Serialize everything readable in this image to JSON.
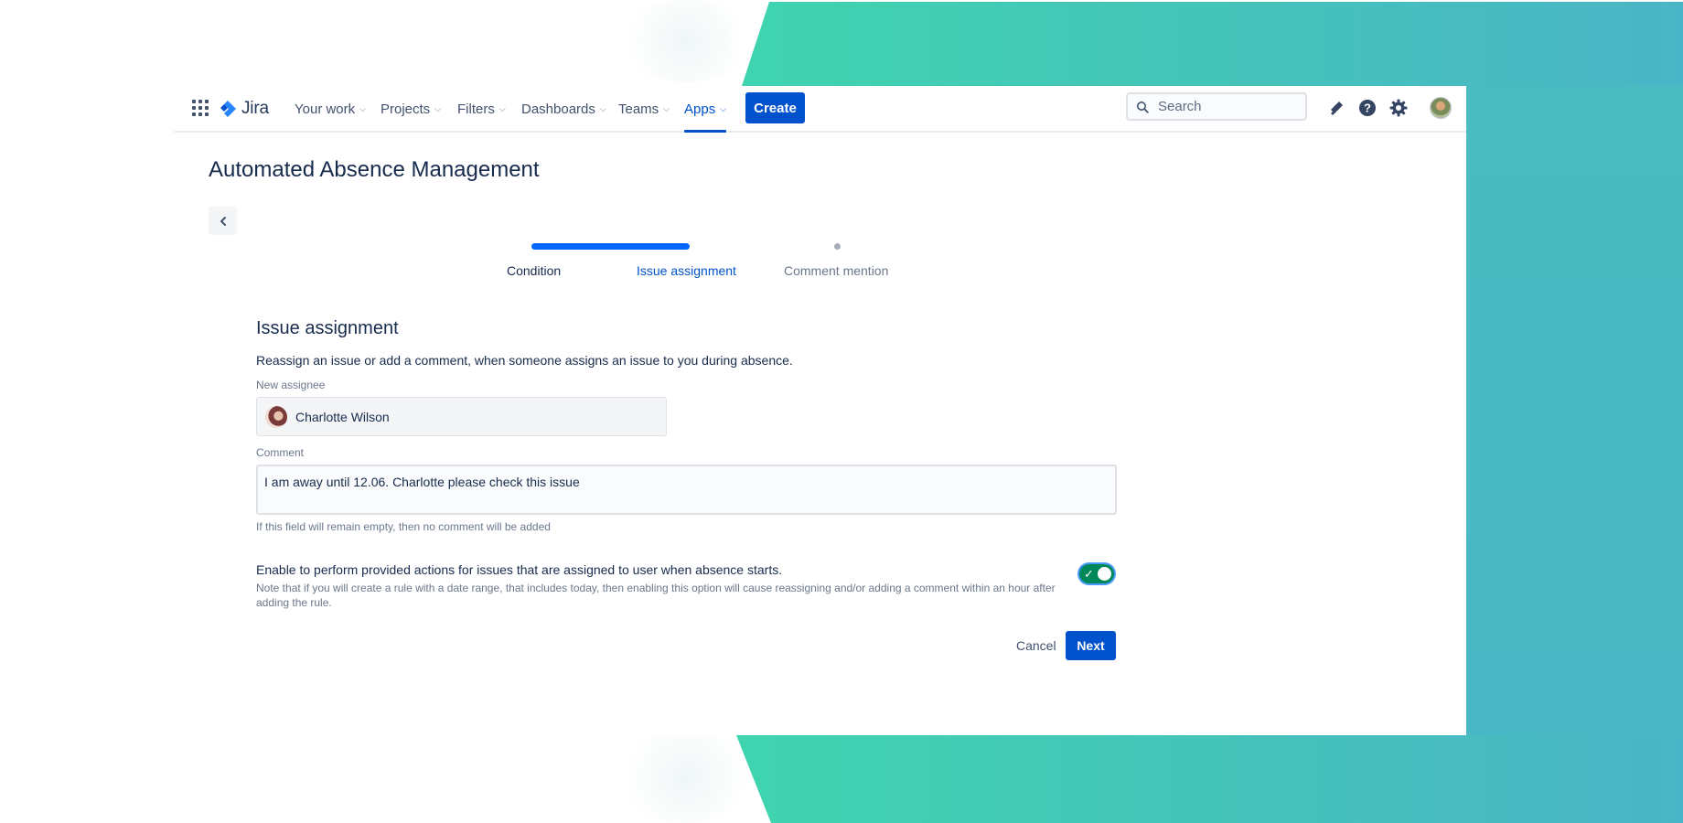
{
  "theme": {
    "brand": "#0052cc",
    "accent": "#0065ff",
    "toggle_on": "#00875a",
    "bg_gradient_start": "#3fd4af",
    "bg_gradient_end": "#4ab5c6"
  },
  "nav": {
    "app_switcher_icon": "grid-icon",
    "logo_text": "Jira",
    "items": [
      {
        "label": "Your work"
      },
      {
        "label": "Projects"
      },
      {
        "label": "Filters"
      },
      {
        "label": "Dashboards"
      },
      {
        "label": "Teams"
      },
      {
        "label": "Apps",
        "active": true
      }
    ],
    "create_label": "Create",
    "search_placeholder": "Search",
    "icons": [
      "notifications-icon",
      "help-icon",
      "settings-icon",
      "avatar"
    ]
  },
  "page": {
    "title": "Automated Absence Management",
    "back_icon": "chevron-left-icon"
  },
  "stepper": {
    "steps": [
      {
        "label": "Condition",
        "state": "done"
      },
      {
        "label": "Issue assignment",
        "state": "current"
      },
      {
        "label": "Comment mention",
        "state": "pending"
      }
    ]
  },
  "form": {
    "section_title": "Issue assignment",
    "description": "Reassign an issue or add a comment, when someone assigns an issue to you during absence.",
    "assignee_label": "New assignee",
    "assignee_value": "Charlotte Wilson",
    "comment_label": "Comment",
    "comment_value": "I am away until 12.06. Charlotte please check this issue",
    "comment_helper": "If this field will remain empty, then no comment will be added",
    "toggle_label": "Enable to perform provided actions for issues that are assigned to user when absence starts.",
    "toggle_note": "Note that if you will create a rule with a date range, that includes today, then enabling this option will cause reassigning and/or adding a comment within an hour after adding the rule.",
    "toggle_on": true,
    "cancel_label": "Cancel",
    "next_label": "Next"
  }
}
